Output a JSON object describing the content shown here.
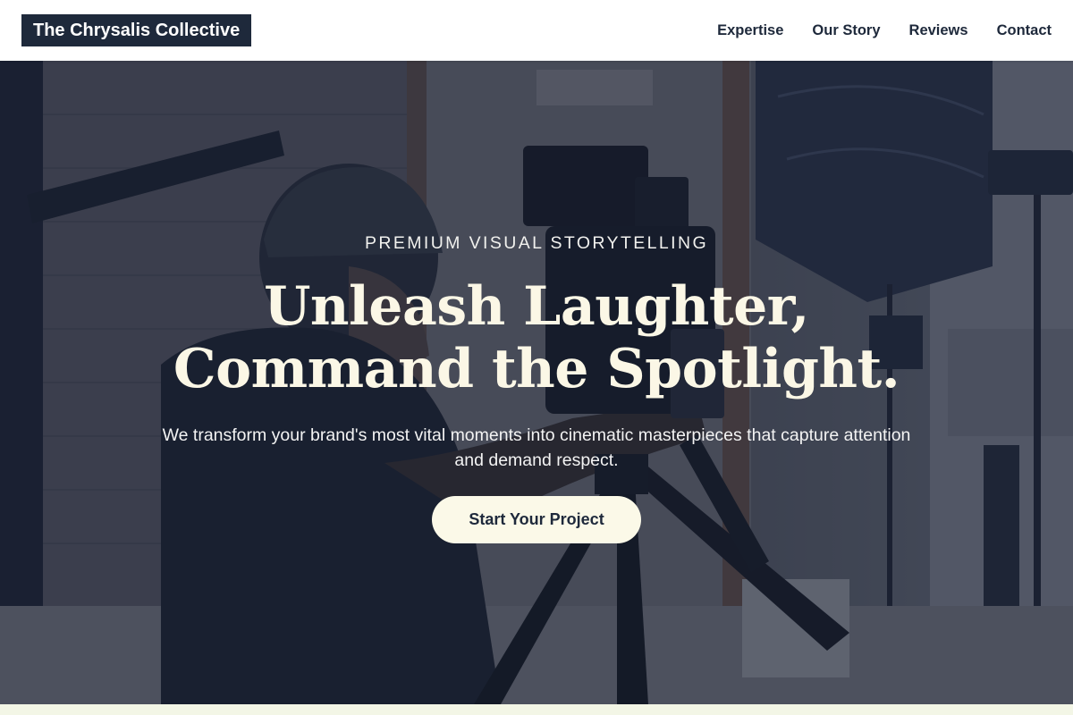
{
  "header": {
    "brand": "The Chrysalis Collective",
    "nav": [
      {
        "label": "Expertise"
      },
      {
        "label": "Our Story"
      },
      {
        "label": "Reviews"
      },
      {
        "label": "Contact"
      }
    ]
  },
  "hero": {
    "eyebrow": "PREMIUM VISUAL STORYTELLING",
    "headline_line1": "Unleash Laughter,",
    "headline_line2": "Command the Spotlight.",
    "lead": "We transform your brand's most vital moments into cinematic masterpieces that capture attention and demand respect.",
    "cta_label": "Start Your Project",
    "background_image": "videographer-with-camera-on-tripod"
  },
  "colors": {
    "brand_bg": "#1e293b",
    "nav_text": "#1e293b",
    "headline": "#fbf7e6",
    "cta_bg": "#fbf9e8",
    "overlay": "#182034"
  }
}
